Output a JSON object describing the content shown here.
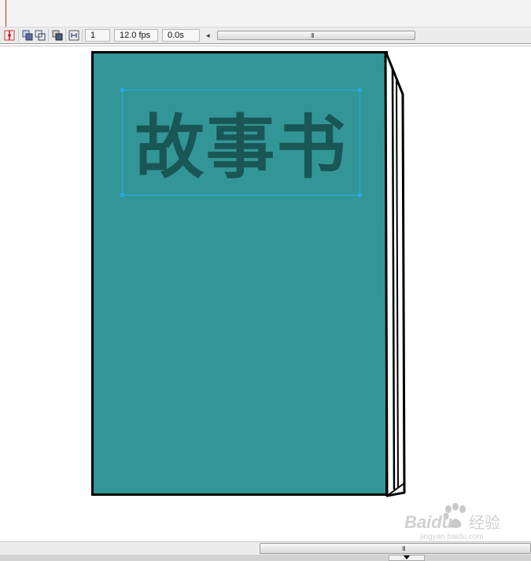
{
  "timeline": {
    "frame_number": "1",
    "frame_rate": "12.0 fps",
    "elapsed_time": "0.0s"
  },
  "stage": {
    "cover_title": "故事书",
    "colors": {
      "cover": "#339696",
      "title_text": "#1a5656",
      "selection": "#2aa7e6",
      "outline": "#000000"
    }
  },
  "icons": [
    "playhead-icon",
    "onion-skin-icon",
    "onion-skin-outlines-icon",
    "edit-multiple-frames-icon",
    "modify-onion-markers-icon",
    "scroll-left-icon",
    "scroll-down-icon"
  ],
  "watermark": {
    "brand": "Baidu",
    "suffix": "经验",
    "url": "jingyan.baidu.com"
  }
}
